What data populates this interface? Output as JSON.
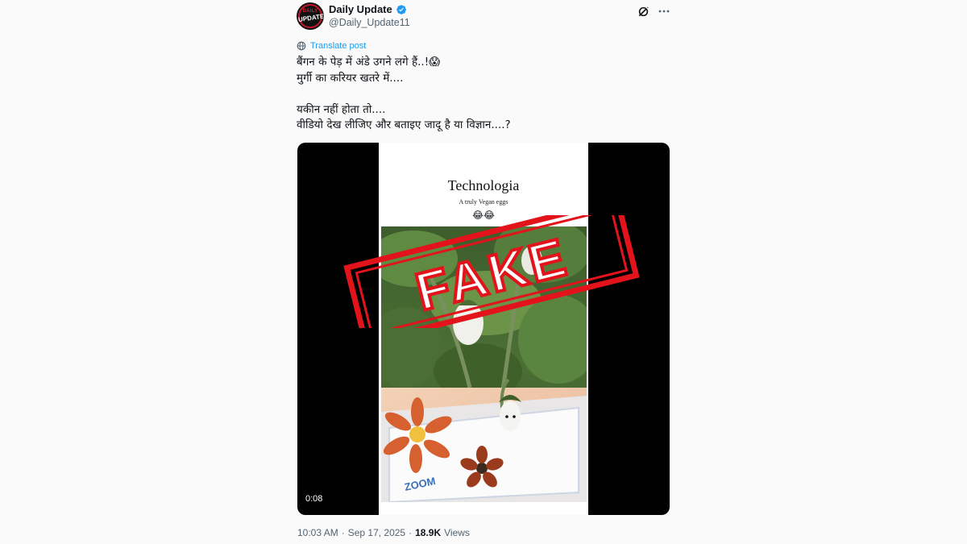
{
  "account": {
    "name": "Daily Update",
    "handle": "@Daily_Update11",
    "avatar_text_top": "DAILY",
    "avatar_text_main": "UPDATE",
    "verified_color": "#1d9bf0"
  },
  "header_icons": [
    "grok-icon",
    "more-icon"
  ],
  "translate_label": "Translate post",
  "post_text": "बैंगन के पेड़ में अंडे उगने लगे हैं..!😱\nमुर्गी का करियर खतरे में....\n\nयकीन नहीं होता तो....\nवीडियो देख लीजिए और बताइए जादू है या विज्ञान....?",
  "video": {
    "title": "Technologia",
    "subtitle": "A truly Vegan eggs",
    "emoji": "😂😂",
    "duration": "0:08",
    "tray_brand": "ZOOM",
    "stamp_text": "FAKE",
    "stamp_color": "#e3131c"
  },
  "meta": {
    "time": "10:03 AM",
    "separator": "·",
    "date": "Sep 17, 2025",
    "views_count": "18.9K",
    "views_label": "Views"
  }
}
